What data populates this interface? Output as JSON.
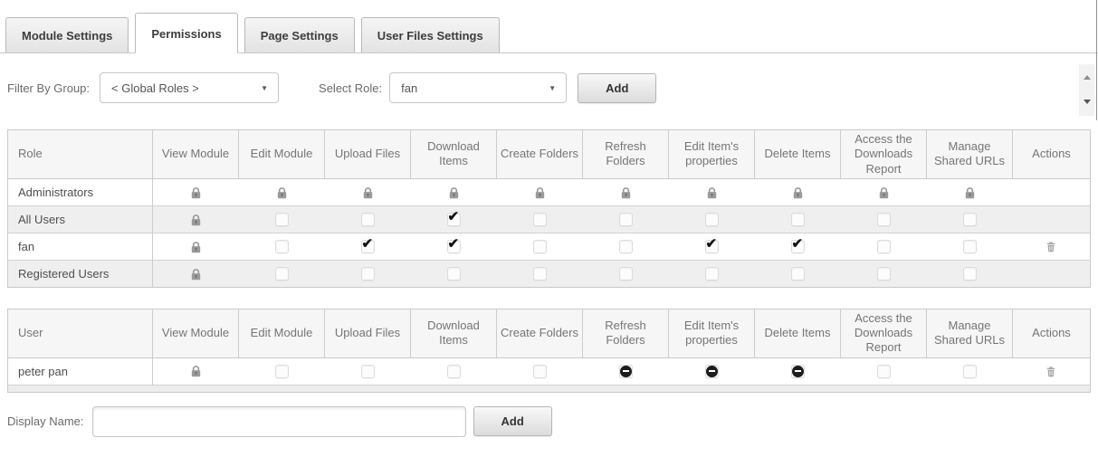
{
  "tabs": [
    {
      "label": "Module Settings",
      "active": false
    },
    {
      "label": "Permissions",
      "active": true
    },
    {
      "label": "Page Settings",
      "active": false
    },
    {
      "label": "User Files Settings",
      "active": false
    }
  ],
  "toolbar": {
    "filter_label": "Filter By Group:",
    "filter_value": "< Global Roles >",
    "role_label": "Select Role:",
    "role_value": "fan",
    "add_button": "Add"
  },
  "permission_columns": [
    "View Module",
    "Edit Module",
    "Upload Files",
    "Download Items",
    "Create Folders",
    "Refresh Folders",
    "Edit Item's properties",
    "Delete Items",
    "Access the Downloads Report",
    "Manage Shared URLs"
  ],
  "actions_column": "Actions",
  "roles_table": {
    "first_column": "Role",
    "rows": [
      {
        "name": "Administrators",
        "states": [
          "lock",
          "lock",
          "lock",
          "lock",
          "lock",
          "lock",
          "lock",
          "lock",
          "lock",
          "lock"
        ],
        "action": "none"
      },
      {
        "name": "All Users",
        "states": [
          "lock",
          "unchecked",
          "unchecked",
          "checked",
          "unchecked",
          "unchecked",
          "unchecked",
          "unchecked",
          "unchecked",
          "unchecked"
        ],
        "action": "none"
      },
      {
        "name": "fan",
        "states": [
          "lock",
          "unchecked",
          "checked",
          "checked",
          "unchecked",
          "unchecked",
          "checked",
          "checked",
          "unchecked",
          "unchecked"
        ],
        "action": "delete"
      },
      {
        "name": "Registered Users",
        "states": [
          "lock",
          "unchecked",
          "unchecked",
          "unchecked",
          "unchecked",
          "unchecked",
          "unchecked",
          "unchecked",
          "unchecked",
          "unchecked"
        ],
        "action": "none"
      }
    ]
  },
  "users_table": {
    "first_column": "User",
    "rows": [
      {
        "name": "peter pan",
        "states": [
          "lock",
          "unchecked",
          "unchecked",
          "unchecked",
          "unchecked",
          "denied",
          "denied",
          "denied",
          "unchecked",
          "unchecked"
        ],
        "action": "delete"
      }
    ]
  },
  "footer": {
    "display_name_label": "Display Name:",
    "display_name_value": "",
    "add_button": "Add"
  },
  "colors": {
    "tab_active_bg": "#ffffff",
    "tab_inactive_bg": "#ececec",
    "table_header_bg": "#f6f6f6",
    "row_alt_bg": "#efefef",
    "border": "#c9c9c9",
    "icon_gray": "#9a9a9a",
    "check_color": "#121212",
    "deny_color": "#1c1c1c"
  }
}
